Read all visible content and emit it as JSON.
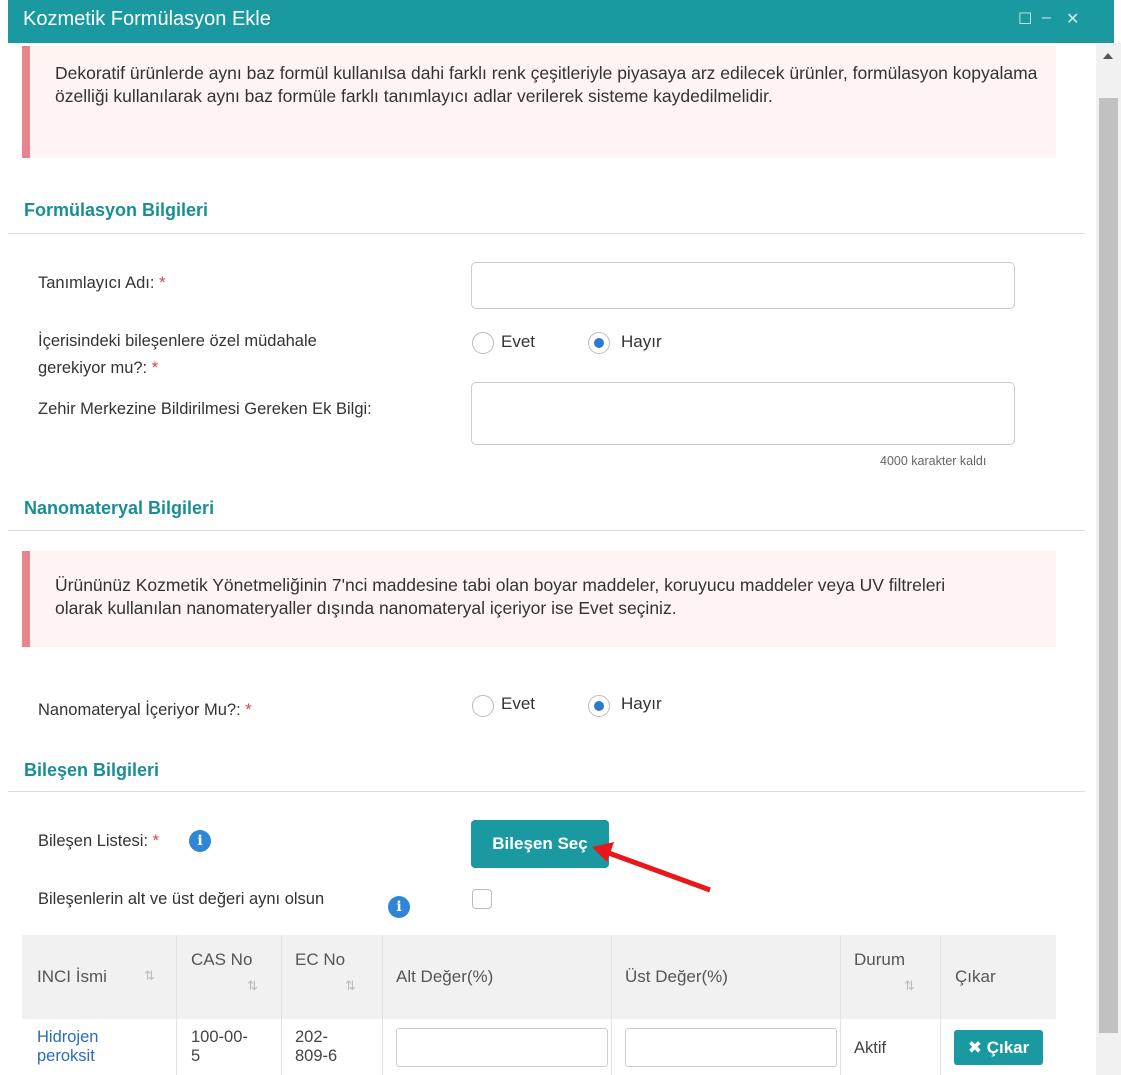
{
  "window": {
    "title": "Kozmetik Formülasyon Ekle",
    "controls": [
      "maximize",
      "minimize",
      "close"
    ]
  },
  "alert_top": {
    "text": "Dekoratif ürünlerde aynı baz formül kullanılsa dahi farklı renk çeşitleriyle piyasaya arz edilecek ürünler, formülasyon kopyalama özelliği kullanılarak aynı baz formüle farklı tanımlayıcı adlar verilerek sisteme kaydedilmelidir."
  },
  "formulation": {
    "heading": "Formülasyon Bilgileri",
    "identifier_label": "Tanımlayıcı Adı:",
    "identifier_value": "",
    "intervention_label_line1": "İçerisindeki bileşenlere özel müdahale",
    "intervention_label_line2": "gerekiyor mu?:",
    "intervention_options": [
      "Evet",
      "Hayır"
    ],
    "intervention_selected": "Hayır",
    "poison_label": "Zehir Merkezine Bildirilmesi Gereken Ek Bilgi:",
    "poison_value": "",
    "char_counter": "4000 karakter kaldı"
  },
  "nano": {
    "heading": "Nanomateryal Bilgileri",
    "alert": "Ürününüz Kozmetik Yönetmeliğinin 7'nci maddesine tabi olan boyar maddeler, koruyucu maddeler veya UV filtreleri olarak kullanılan nanomateryaller dışında nanomateryal içeriyor ise Evet seçiniz.",
    "question_label": "Nanomateryal İçeriyor Mu?:",
    "options": [
      "Evet",
      "Hayır"
    ],
    "selected": "Hayır"
  },
  "components": {
    "heading": "Bileşen Bilgileri",
    "list_label": "Bileşen Listesi:",
    "select_button": "Bileşen Seç",
    "same_values_label": "Bileşenlerin alt ve üst değeri aynı olsun",
    "same_values_checked": false,
    "table": {
      "columns": [
        "INCI İsmi",
        "CAS No",
        "EC No",
        "Alt Değer(%)",
        "Üst Değer(%)",
        "Durum",
        "Çıkar"
      ],
      "rows": [
        {
          "inci_line1": "Hidrojen",
          "inci_line2": "peroksit",
          "cas_line1": "100-00-",
          "cas_line2": "5",
          "ec_line1": "202-",
          "ec_line2": "809-6",
          "lower": "",
          "upper": "",
          "status": "Aktif",
          "remove_label": "Çıkar"
        }
      ]
    }
  },
  "colors": {
    "primary": "#1a9aa0",
    "heading": "#1a8e96",
    "alert_bg": "#fdf4f3",
    "alert_border": "#e8848c",
    "radio_selected": "#2a7ad1",
    "required": "#e04040",
    "annotation_arrow": "#e8171b"
  },
  "icons": {
    "maximize": "maximize-icon",
    "minimize": "minimize-icon",
    "close": "close-icon",
    "info": "info-icon",
    "sort": "sort-icon",
    "remove": "x-icon"
  }
}
